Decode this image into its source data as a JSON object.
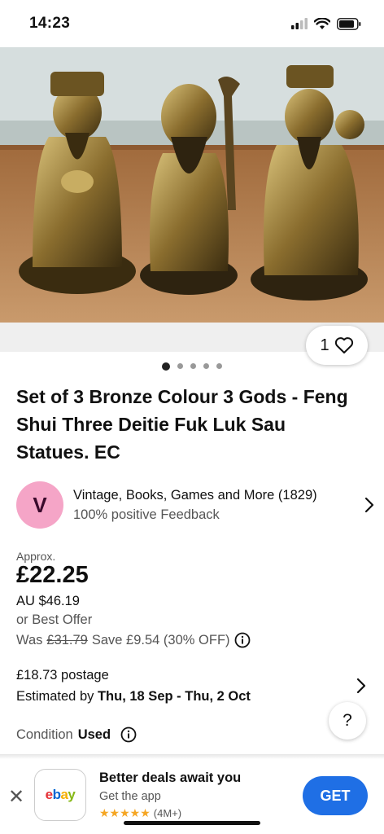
{
  "status": {
    "time": "14:23"
  },
  "listing": {
    "favorite_count": "1",
    "image_count": 5,
    "image_active": 1,
    "title": "Set of 3 Bronze Colour 3 Gods - Feng Shui Three Deitie Fuk Luk Sau Statues. EC"
  },
  "seller": {
    "initial": "V",
    "name": "Vintage, Books, Games and More (1829)",
    "feedback": "100% positive Feedback",
    "avatar_color": "#f5a5c7"
  },
  "pricing": {
    "approx_label": "Approx.",
    "price": "£22.25",
    "price_local": "AU $46.19",
    "best_offer": "or Best Offer",
    "was_label": "Was",
    "was_price": "£31.79",
    "save_text": "Save £9.54 (30% OFF)"
  },
  "shipping": {
    "postage": "£18.73 postage",
    "estimated_label": "Estimated by",
    "estimated_dates": "Thu, 18 Sep - Thu, 2 Oct"
  },
  "condition": {
    "label": "Condition",
    "value": "Used"
  },
  "help": {
    "label": "?"
  },
  "app_banner": {
    "close": "✕",
    "app_name": "ebay",
    "title": "Better deals await you",
    "subtitle": "Get the app",
    "stars": "★★★★★",
    "rating_count": "(4M+)",
    "get_label": "GET",
    "accent": "#1f6fe5"
  }
}
